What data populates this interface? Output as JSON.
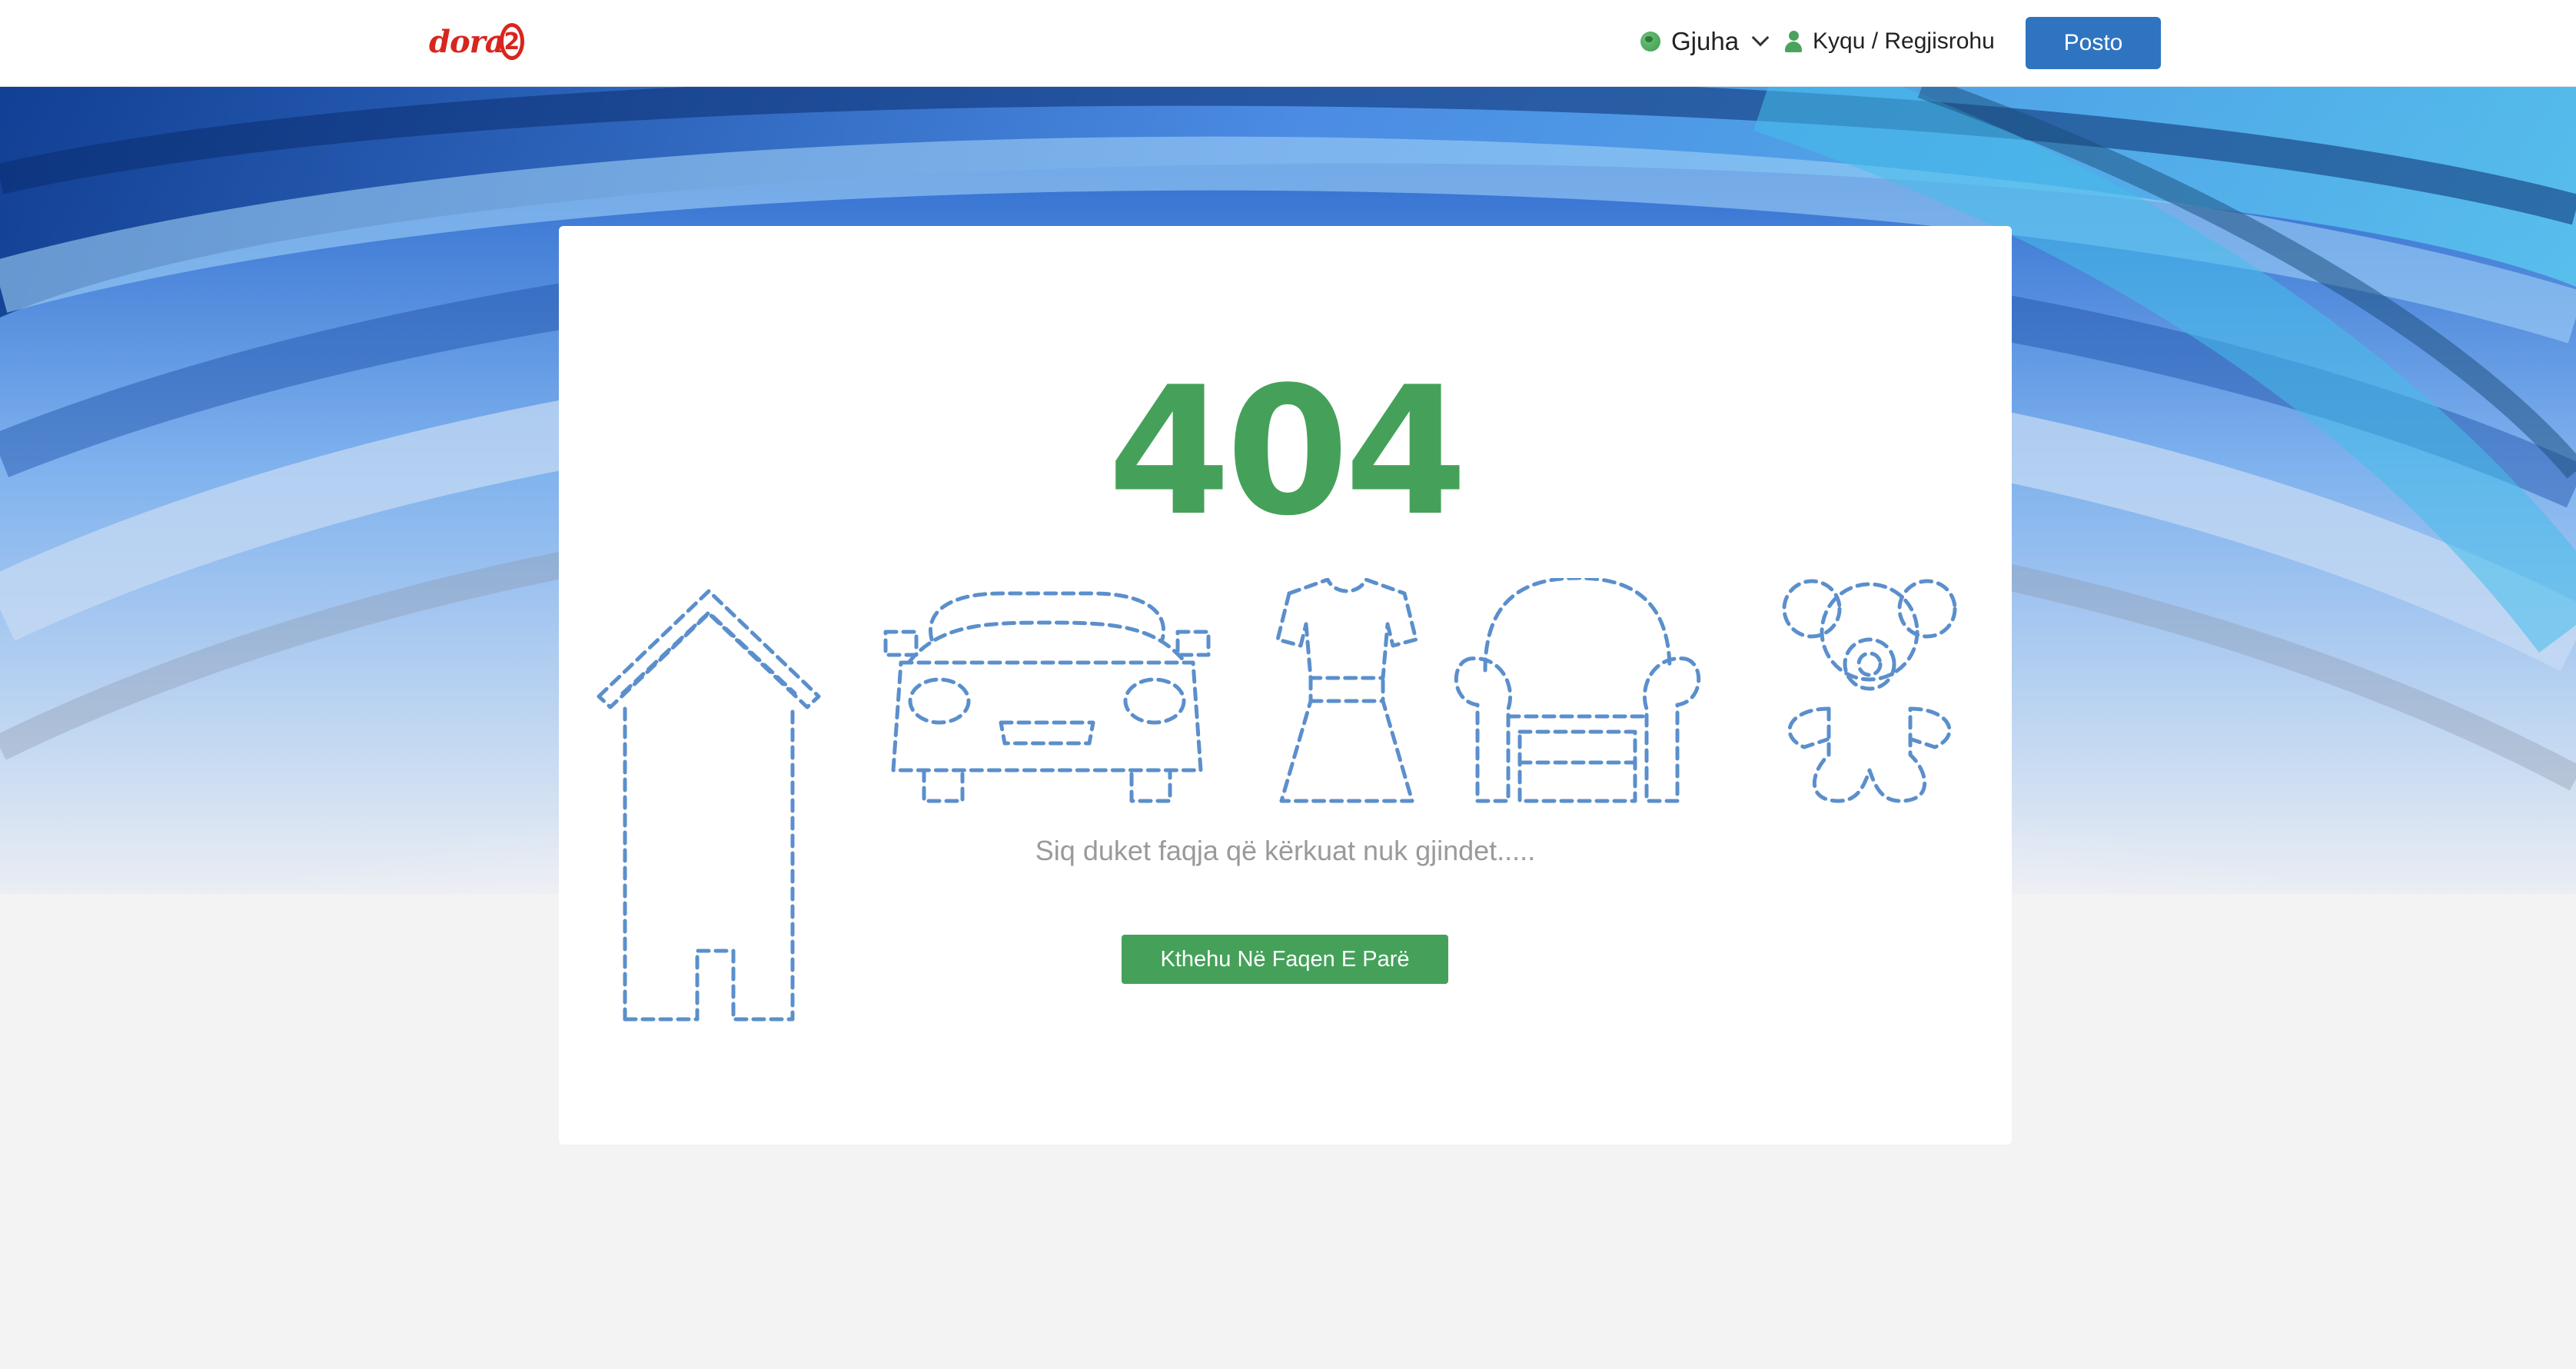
{
  "header": {
    "logo_text": "dora",
    "logo_badge": "2",
    "language_label": "Gjuha",
    "login_label": "Kyqu / Regjisrohu",
    "post_button_label": "Posto"
  },
  "main": {
    "error_code": "404",
    "message": "Siq duket faqja që kërkuat nuk gjindet.....",
    "home_button_label": "Kthehu Në Faqen E Parë",
    "illustration_icons": [
      "house-icon",
      "car-icon",
      "dress-icon",
      "armchair-icon",
      "teddy-bear-icon"
    ]
  },
  "colors": {
    "accent_green": "#45a15a",
    "primary_blue": "#2f74c0",
    "icon_dash_blue": "#5b8fcc",
    "logo_red": "#d7261e"
  }
}
